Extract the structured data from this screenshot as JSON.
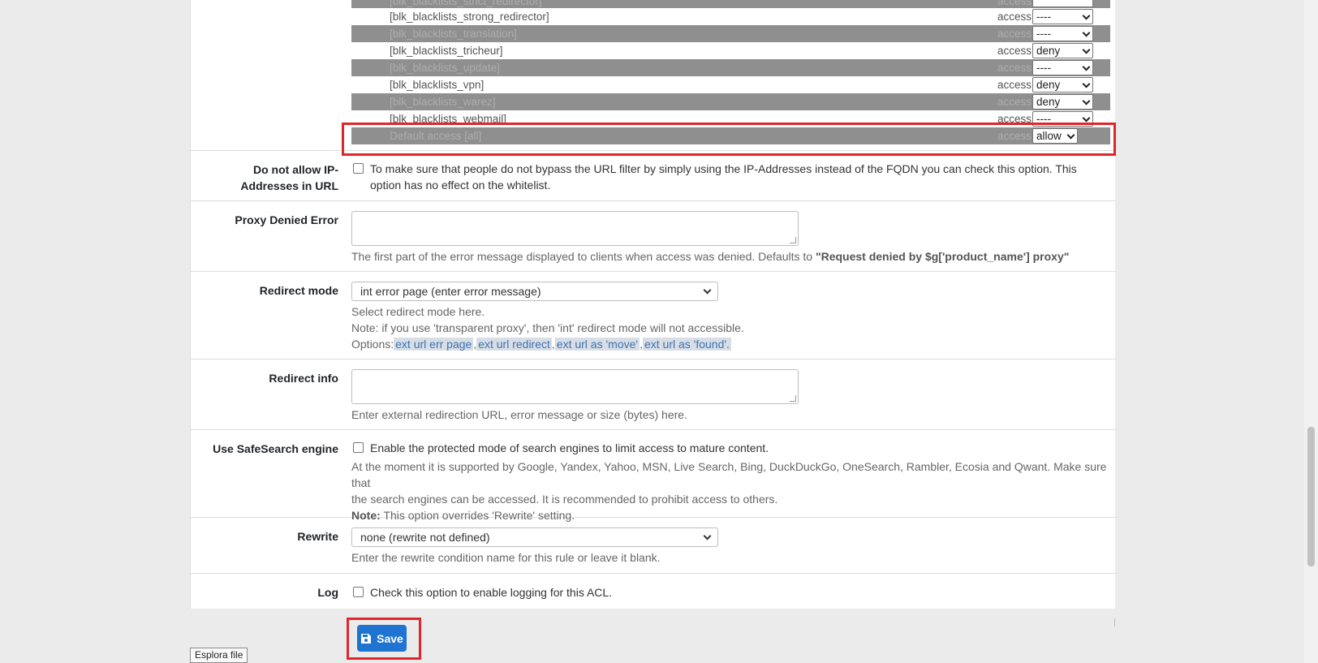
{
  "acl_list": {
    "top_partial": {
      "name": "[blk_blacklists_strict_redirector]",
      "access_label": "access",
      "value": "---"
    },
    "rows": [
      {
        "name": "[blk_blacklists_strong_redirector]",
        "access_label": "access",
        "value": "----",
        "shaded": false
      },
      {
        "name": "[blk_blacklists_translation]",
        "access_label": "access",
        "value": "----",
        "shaded": true
      },
      {
        "name": "[blk_blacklists_tricheur]",
        "access_label": "access",
        "value": "deny",
        "shaded": false
      },
      {
        "name": "[blk_blacklists_update]",
        "access_label": "access",
        "value": "----",
        "shaded": true
      },
      {
        "name": "[blk_blacklists_vpn]",
        "access_label": "access",
        "value": "deny",
        "shaded": false
      },
      {
        "name": "[blk_blacklists_warez]",
        "access_label": "access",
        "value": "deny",
        "shaded": true
      },
      {
        "name": "[blk_blacklists_webmail]",
        "access_label": "access",
        "value": "----",
        "shaded": false
      }
    ],
    "default_row": {
      "name": "Default access [all]",
      "access_label": "access",
      "value": "allow"
    }
  },
  "ip_in_url": {
    "label": "Do not allow IP-Addresses in URL",
    "text": "To make sure that people do not bypass the URL filter by simply using the IP-Addresses instead of the FQDN you can check this option. This option has no effect on the whitelist.",
    "checked": false
  },
  "proxy_denied_error": {
    "label": "Proxy Denied Error",
    "value": "",
    "help_prefix": "The first part of the error message displayed to clients when access was denied. Defaults to ",
    "help_bold": "\"Request denied by $g['product_name'] proxy\""
  },
  "redirect_mode": {
    "label": "Redirect mode",
    "selected": "int error page (enter error message)",
    "help_line1": "Select redirect mode here.",
    "help_line2": "Note: if you use 'transparent proxy', then 'int' redirect mode will not accessible.",
    "options_prefix": "Options:",
    "options": [
      "ext url err page",
      "ext url redirect",
      "ext url as 'move'",
      "ext url as 'found'."
    ]
  },
  "redirect_info": {
    "label": "Redirect info",
    "value": "",
    "help": "Enter external redirection URL, error message or size (bytes) here."
  },
  "safesearch": {
    "label": "Use SafeSearch engine",
    "text": "Enable the protected mode of search engines to limit access to mature content.",
    "help_line1": "At the moment it is supported by Google, Yandex, Yahoo, MSN, Live Search, Bing, DuckDuckGo, OneSearch, Rambler, Ecosia and Qwant. Make sure that",
    "help_line2": "the search engines can be accessed. It is recommended to prohibit access to others.",
    "note_bold": "Note:",
    "note_text": " This option overrides 'Rewrite' setting.",
    "checked": false
  },
  "rewrite": {
    "label": "Rewrite",
    "selected": "none (rewrite not defined)",
    "help": "Enter the rewrite condition name for this rule or leave it blank."
  },
  "log": {
    "label": "Log",
    "text": "Check this option to enable logging for this ACL.",
    "checked": false
  },
  "save_button": {
    "label": "Save",
    "icon": "floppy-disk-icon"
  },
  "tooltip": {
    "text": "Esplora file"
  },
  "colors": {
    "highlight": "#e0262c",
    "primary": "#1e74d0",
    "shaded_row": "#8f8f8f"
  }
}
